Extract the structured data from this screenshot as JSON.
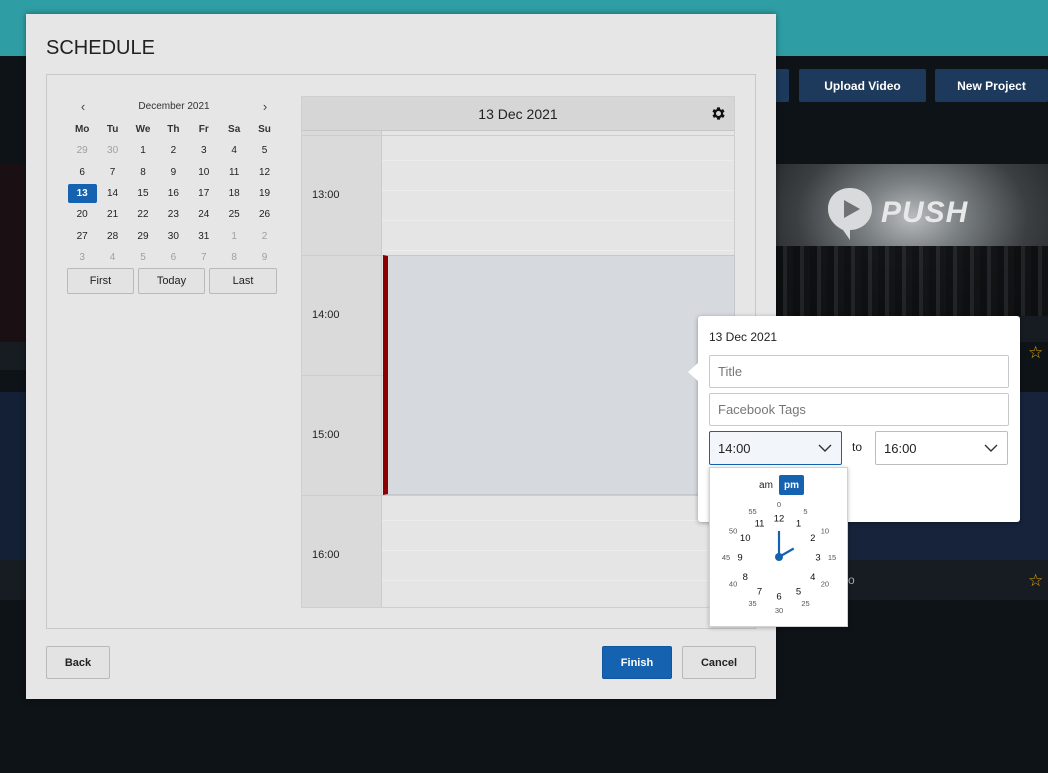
{
  "background": {
    "upload_video": "Upload Video",
    "new_project": "New Project",
    "push_brand": "PUSH",
    "partial_card_text": "o"
  },
  "modal": {
    "title": "SCHEDULE",
    "back": "Back",
    "finish": "Finish",
    "cancel": "Cancel"
  },
  "calendar": {
    "prev": "‹",
    "next": "›",
    "month": "December 2021",
    "weekdays": [
      "Mo",
      "Tu",
      "We",
      "Th",
      "Fr",
      "Sa",
      "Su"
    ],
    "weeks": [
      [
        "29",
        "30",
        "1",
        "2",
        "3",
        "4",
        "5"
      ],
      [
        "6",
        "7",
        "8",
        "9",
        "10",
        "11",
        "12"
      ],
      [
        "13",
        "14",
        "15",
        "16",
        "17",
        "18",
        "19"
      ],
      [
        "20",
        "21",
        "22",
        "23",
        "24",
        "25",
        "26"
      ],
      [
        "27",
        "28",
        "29",
        "30",
        "31",
        "1",
        "2"
      ],
      [
        "3",
        "4",
        "5",
        "6",
        "7",
        "8",
        "9"
      ]
    ],
    "selected": "13",
    "buttons": {
      "first": "First",
      "today": "Today",
      "last": "Last"
    }
  },
  "day_view": {
    "date": "13 Dec 2021",
    "hours": [
      "13:00",
      "14:00",
      "15:00",
      "16:00"
    ],
    "event_color": "#8b0000"
  },
  "popover": {
    "date": "13 Dec 2021",
    "title_placeholder": "Title",
    "tags_placeholder": "Facebook Tags",
    "start_time": "14:00",
    "to": "to",
    "end_time": "16:00"
  },
  "clock": {
    "am": "am",
    "pm": "pm",
    "hours": [
      "12",
      "1",
      "2",
      "3",
      "4",
      "5",
      "6",
      "7",
      "8",
      "9",
      "10",
      "11"
    ],
    "minutes": [
      "0",
      "5",
      "10",
      "15",
      "20",
      "25",
      "30",
      "35",
      "40",
      "45",
      "50",
      "55"
    ],
    "selected_hour": 2
  },
  "colors": {
    "accent": "#1462b0",
    "topbar": "#2e9ea4",
    "star": "#e2a400"
  }
}
